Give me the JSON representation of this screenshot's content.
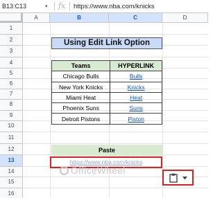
{
  "formula_bar": {
    "name_box": "B13:C13",
    "name_box_caret": "▾",
    "fx_label": "fx",
    "content": "https://www.nba.com/knicks"
  },
  "columns": [
    "A",
    "B",
    "C",
    "D"
  ],
  "rows": [
    "1",
    "2",
    "3",
    "4",
    "5",
    "6",
    "7",
    "8",
    "9",
    "10",
    "11",
    "12",
    "13",
    "14",
    "15",
    "16"
  ],
  "title": "Using Edit Link Option",
  "table": {
    "headers": [
      "Teams",
      "HYPERLINK"
    ],
    "rows": [
      {
        "team": "Chicago Bulls",
        "link": "Bulls"
      },
      {
        "team": "New York Knicks",
        "link": "Knicks"
      },
      {
        "team": "Miami Heat",
        "link": "Heat"
      },
      {
        "team": "Phoenix Suns",
        "link": "Suns"
      },
      {
        "team": "Detroit Pistons",
        "link": "Piston"
      }
    ]
  },
  "paste": {
    "header": "Paste",
    "value": "https://www.nba.com/knicks"
  },
  "watermark": "OfficeWheel",
  "paste_options": {
    "icon": "clipboard-icon",
    "caret": "chevron-down-icon"
  },
  "colors": {
    "title_bg": "#c9daf8",
    "header_bg": "#d9ead3",
    "link": "#1155cc",
    "highlight": "#e02020",
    "selection": "#d3e3fd"
  }
}
